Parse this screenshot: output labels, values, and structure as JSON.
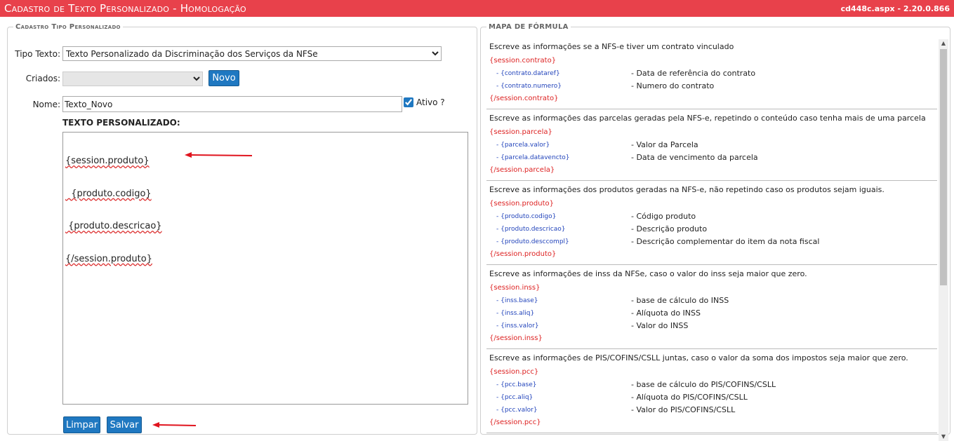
{
  "header": {
    "title": "Cadastro de Texto Personalizado  - Homologação",
    "version": "cd448c.aspx - 2.20.0.866"
  },
  "left": {
    "legend": "Cadastro Tipo Personalizado",
    "tipo_label": "Tipo Texto:",
    "tipo_value": "Texto Personalizado da Discriminação dos Serviços da NFSe",
    "criados_label": "Criados:",
    "criados_value": "",
    "novo_button": "Novo",
    "nome_label": "Nome:",
    "nome_value": "Texto_Novo",
    "ativo_label": "Ativo ?",
    "ativo_checked": true,
    "section_title": "TEXTO PERSONALIZADO:",
    "editor_lines": [
      "{session.produto}",
      "  {produto.codigo}",
      " {produto.descricao}",
      "{/session.produto}"
    ],
    "limpar_button": "Limpar",
    "salvar_button": "Salvar",
    "arrow_color": "#e0141e"
  },
  "right": {
    "legend": "MAPA DE FÓRMULA",
    "sections": [
      {
        "desc": "Escreve as informações se a NFS-e tiver um contrato vinculado",
        "open": "{session.contrato}",
        "rows": [
          {
            "var": "{contrato.dataref}",
            "text": "- Data de referência do contrato"
          },
          {
            "var": "{contrato.numero}",
            "text": "- Numero do contrato"
          }
        ],
        "close": "{/session.contrato}"
      },
      {
        "desc": "Escreve as informações das parcelas geradas pela NFS-e, repetindo o conteúdo caso tenha mais de uma parcela",
        "open": "{session.parcela}",
        "rows": [
          {
            "var": "{parcela.valor}",
            "text": "- Valor da Parcela"
          },
          {
            "var": "{parcela.datavencto}",
            "text": "- Data de vencimento da parcela"
          }
        ],
        "close": "{/session.parcela}"
      },
      {
        "desc": "Escreve as informações dos produtos geradas na NFS-e, não repetindo caso os produtos sejam iguais.",
        "open": "{session.produto}",
        "rows": [
          {
            "var": "{produto.codigo}",
            "text": "- Código produto"
          },
          {
            "var": "{produto.descricao}",
            "text": "- Descrição produto"
          },
          {
            "var": "{produto.desccompl}",
            "text": "- Descrição complementar do item da nota fiscal"
          }
        ],
        "close": "{/session.produto}"
      },
      {
        "desc": "Escreve as informações de inss da NFSe, caso o valor do inss seja maior que zero.",
        "open": "{session.inss}",
        "rows": [
          {
            "var": "{inss.base}",
            "text": "- base de cálculo do INSS"
          },
          {
            "var": "{inss.aliq}",
            "text": "- Alíquota do INSS"
          },
          {
            "var": "{inss.valor}",
            "text": "- Valor do INSS"
          }
        ],
        "close": "{/session.inss}"
      },
      {
        "desc": "Escreve as informações de PIS/COFINS/CSLL juntas, caso o valor da soma dos impostos seja maior que zero.",
        "open": "{session.pcc}",
        "rows": [
          {
            "var": "{pcc.base}",
            "text": "- base de cálculo do PIS/COFINS/CSLL"
          },
          {
            "var": "{pcc.aliq}",
            "text": "- Alíquota do PIS/COFINS/CSLL"
          },
          {
            "var": "{pcc.valor}",
            "text": "- Valor do PIS/COFINS/CSLL"
          }
        ],
        "close": "{/session.pcc}"
      }
    ]
  }
}
